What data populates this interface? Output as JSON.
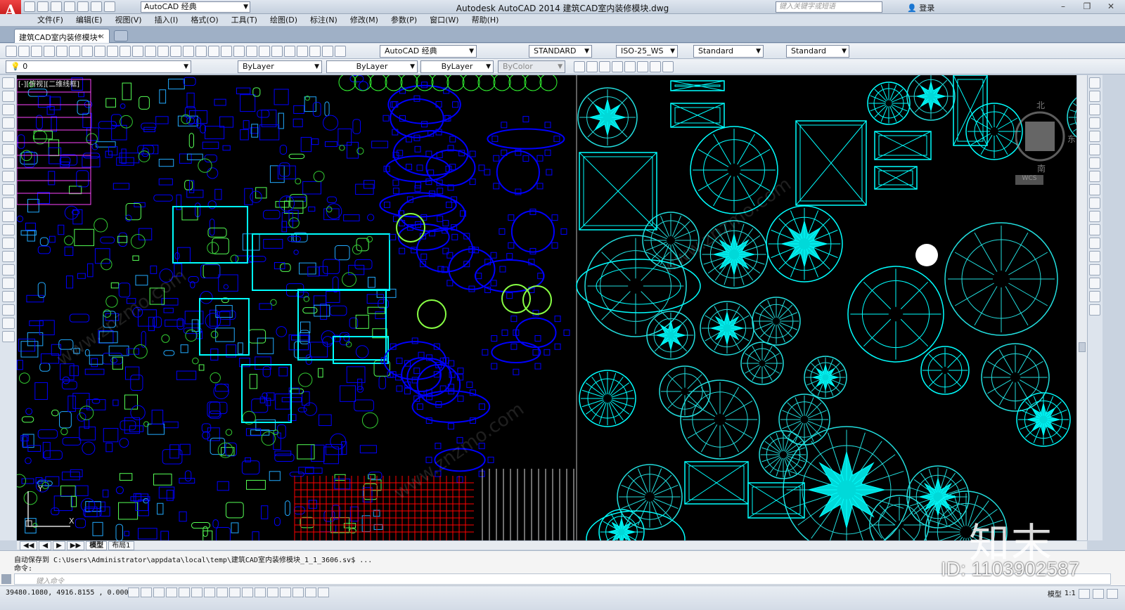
{
  "titlebar": {
    "app_logo": "A",
    "workspace": "AutoCAD 经典",
    "title": "Autodesk AutoCAD 2014    建筑CAD室内装修模块.dwg",
    "search_placeholder": "键入关键字或短语",
    "login": "登录"
  },
  "menu": [
    "文件(F)",
    "编辑(E)",
    "视图(V)",
    "插入(I)",
    "格式(O)",
    "工具(T)",
    "绘图(D)",
    "标注(N)",
    "修改(M)",
    "参数(P)",
    "窗口(W)",
    "帮助(H)"
  ],
  "doc_tab": {
    "label": "建筑CAD室内装修模块*",
    "close": "×"
  },
  "toolbar1": {
    "workspace": "AutoCAD 经典",
    "text_style": "STANDARD",
    "dim_style": "ISO-25_WS",
    "table_style": "Standard",
    "mleader_style": "Standard"
  },
  "toolbar2": {
    "layer": "0",
    "color": "ByLayer",
    "linetype": "ByLayer",
    "lineweight": "ByLayer",
    "plotstyle": "ByColor"
  },
  "canvas": {
    "view_label": "[-][俯视][二维线框]",
    "ucs_y": "Y",
    "ucs_x": "X",
    "nav_north": "北",
    "nav_south": "南",
    "nav_east": "东",
    "nav_wcs": "WCS"
  },
  "layout_tabs": [
    "模型",
    "布局1"
  ],
  "command": {
    "line1": "自动保存到 C:\\Users\\Administrator\\appdata\\local\\temp\\建筑CAD室内装修模块_1_1_3606.sv$ ...",
    "line2": "命令:",
    "input_placeholder": "键入命令"
  },
  "status": {
    "coords": "39480.1080,  4916.8155 , 0.0000",
    "model": "模型",
    "scale": "1:1"
  },
  "watermark": {
    "logo": "知末",
    "id": "ID: 1103902587",
    "diag": "www.znzmo.com"
  },
  "colors": {
    "canvas": "#000000",
    "blue": "#0000ff",
    "cyan": "#00ffff",
    "green": "#00ff00",
    "red": "#ff0000"
  }
}
